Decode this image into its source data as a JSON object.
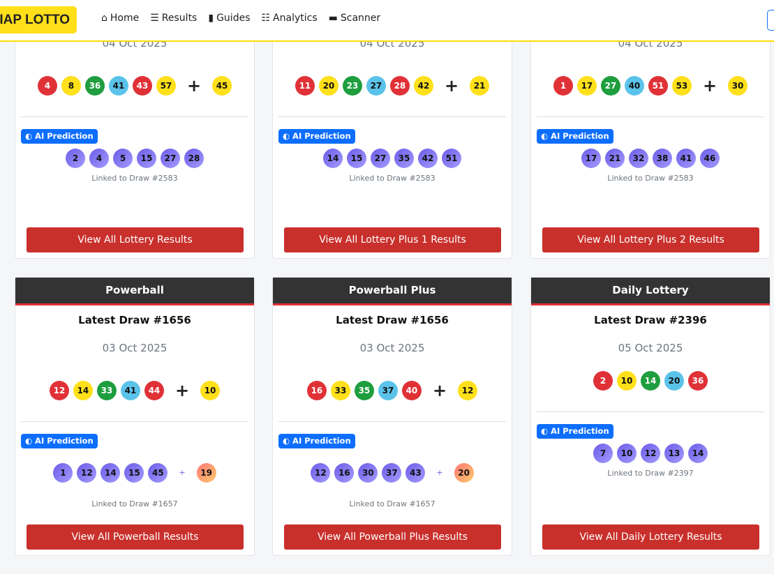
{
  "nav": {
    "logo": "IAP LOTTO",
    "items": [
      {
        "icon": "⌂",
        "label": "Home"
      },
      {
        "icon": "☰",
        "label": "Results"
      },
      {
        "icon": "▮",
        "label": "Guides"
      },
      {
        "icon": "☷",
        "label": "Analytics"
      },
      {
        "icon": "▬",
        "label": "Scanner"
      }
    ]
  },
  "cards": [
    {
      "name": "",
      "title": "Latest Draw #2582",
      "date": "04 Oct 2025",
      "balls": [
        "4",
        "8",
        "36",
        "41",
        "43",
        "57"
      ],
      "bonus": "45",
      "badge": "AI Prediction",
      "pred": [
        "2",
        "4",
        "5",
        "15",
        "27",
        "28"
      ],
      "pred_bonus": null,
      "linked": "Linked to Draw #2583",
      "button": "View All Lottery Results"
    },
    {
      "name": "",
      "title": "Latest Draw #2582",
      "date": "04 Oct 2025",
      "balls": [
        "11",
        "20",
        "23",
        "27",
        "28",
        "42"
      ],
      "bonus": "21",
      "badge": "AI Prediction",
      "pred": [
        "14",
        "15",
        "27",
        "35",
        "42",
        "51"
      ],
      "pred_bonus": null,
      "linked": "Linked to Draw #2583",
      "button": "View All Lottery Plus 1 Results"
    },
    {
      "name": "",
      "title": "Latest Draw #2582",
      "date": "04 Oct 2025",
      "balls": [
        "1",
        "17",
        "27",
        "40",
        "51",
        "53"
      ],
      "bonus": "30",
      "badge": "AI Prediction",
      "pred": [
        "17",
        "21",
        "32",
        "38",
        "41",
        "46"
      ],
      "pred_bonus": null,
      "linked": "Linked to Draw #2583",
      "button": "View All Lottery Plus 2 Results"
    },
    {
      "name": "Powerball",
      "title": "Latest Draw #1656",
      "date": "03 Oct 2025",
      "balls": [
        "12",
        "14",
        "33",
        "41",
        "44"
      ],
      "bonus": "10",
      "badge": "AI Prediction",
      "pred": [
        "1",
        "12",
        "14",
        "15",
        "45"
      ],
      "pred_bonus": "19",
      "linked": "Linked to Draw #1657",
      "button": "View All Powerball Results"
    },
    {
      "name": "Powerball Plus",
      "title": "Latest Draw #1656",
      "date": "03 Oct 2025",
      "balls": [
        "16",
        "33",
        "35",
        "37",
        "40"
      ],
      "bonus": "12",
      "badge": "AI Prediction",
      "pred": [
        "12",
        "16",
        "30",
        "37",
        "43"
      ],
      "pred_bonus": "20",
      "linked": "Linked to Draw #1657",
      "button": "View All Powerball Plus Results"
    },
    {
      "name": "Daily Lottery",
      "title": "Latest Draw #2396",
      "date": "05 Oct 2025",
      "balls": [
        "2",
        "10",
        "14",
        "20",
        "36"
      ],
      "bonus": null,
      "badge": "AI Prediction",
      "pred": [
        "7",
        "10",
        "12",
        "13",
        "14"
      ],
      "pred_bonus": null,
      "linked": "Linked to Draw #2397",
      "button": "View All Daily Lottery Results"
    }
  ],
  "colors": {
    "red": "#e03137",
    "yellow": "#ffe01a",
    "green": "#1e9e3e",
    "blue": "#5bc3ea",
    "accent": "#0d6efd",
    "button": "#c9302c"
  }
}
